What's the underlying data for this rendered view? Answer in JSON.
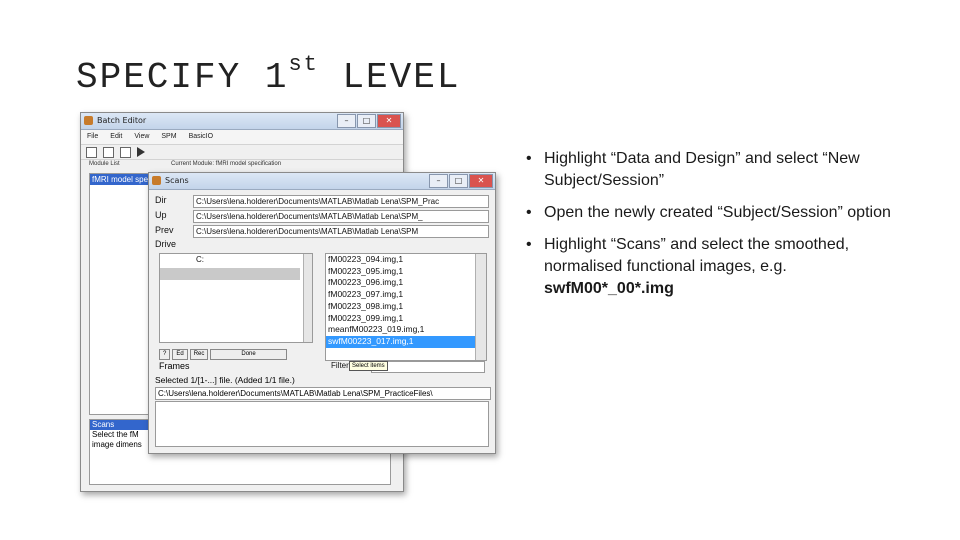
{
  "slide": {
    "title_main": "SPECIFY 1",
    "title_sup": "st",
    "title_end": " LEVEL",
    "bullets": [
      {
        "text": "Highlight “Data and Design” and select “New Subject/Session”"
      },
      {
        "text": "Open the newly created “Subject/Session” option"
      },
      {
        "text_before": "Highlight “Scans” and select the smoothed, normalised functional images, e.g. ",
        "text_bold": "swfM00*_00*.img"
      }
    ]
  },
  "batch_editor": {
    "title": "Batch Editor",
    "menu": [
      "File",
      "Edit",
      "View",
      "SPM",
      "BasicIO"
    ],
    "module_list_header": "Module List",
    "current_module_header": "Current Module: fMRI model specification",
    "module_selected": "fMRI model spe",
    "help_lines": [
      "Scans",
      "Select the fM",
      "image dimens"
    ]
  },
  "scans_dialog": {
    "title": "Scans",
    "labels": {
      "dir": "Dir",
      "up": "Up",
      "prev": "Prev",
      "drive": "Drive"
    },
    "dir_path": "C:\\Users\\lena.holderer\\Documents\\MATLAB\\Matlab Lena\\SPM_Prac",
    "up_path": "C:\\Users\\lena.holderer\\Documents\\MATLAB\\Matlab Lena\\SPM_",
    "prev_path": "C:\\Users\\lena.holderer\\Documents\\MATLAB\\Matlab Lena\\SPM",
    "drive_value": "C:",
    "files": [
      "fM00223_094.img,1",
      "fM00223_095.img,1",
      "fM00223_096.img,1",
      "fM00223_097.img,1",
      "fM00223_098.img,1",
      "fM00223_099.img,1",
      "meanfM00223_019.img,1",
      "swfM00223_017.img,1"
    ],
    "selected_file_index": 7,
    "small_buttons": [
      "?",
      "Ed",
      "Rec",
      "Done"
    ],
    "filter_label": "Filter",
    "tooltip": "Select items",
    "frames_label": "Frames",
    "selected_info": "Selected 1/[1-...] file. (Added 1/1 file.)",
    "selected_path": "C:\\Users\\lena.holderer\\Documents\\MATLAB\\Matlab Lena\\SPM_PracticeFiles\\"
  }
}
